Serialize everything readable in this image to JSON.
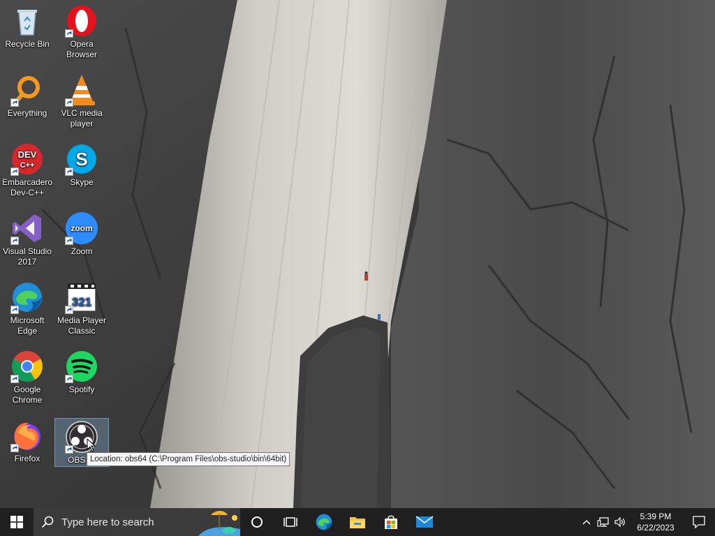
{
  "desktop": {
    "icons": [
      {
        "label": "Recycle Bin",
        "icon": "recycle-bin-icon"
      },
      {
        "label": "Opera Browser",
        "icon": "opera-icon"
      },
      {
        "label": "Everything",
        "icon": "everything-search-icon"
      },
      {
        "label": "VLC media player",
        "icon": "vlc-icon"
      },
      {
        "label": "Embarcadero Dev-C++",
        "icon": "devcpp-icon"
      },
      {
        "label": "Skype",
        "icon": "skype-icon"
      },
      {
        "label": "Visual Studio 2017",
        "icon": "visual-studio-icon"
      },
      {
        "label": "Zoom",
        "icon": "zoom-icon"
      },
      {
        "label": "Microsoft Edge",
        "icon": "edge-icon"
      },
      {
        "label": "Media Player Classic",
        "icon": "media-player-classic-icon"
      },
      {
        "label": "Google Chrome",
        "icon": "chrome-icon"
      },
      {
        "label": "Spotify",
        "icon": "spotify-icon"
      },
      {
        "label": "Firefox",
        "icon": "firefox-icon"
      },
      {
        "label": "OBS St",
        "icon": "obs-icon"
      }
    ],
    "selected": "OBS Studio",
    "tooltip": "Location: obs64 (C:\\Program Files\\obs-studio\\bin\\64bit)",
    "dev_badge": "DEV",
    "dev_badge2": "C++",
    "mpc_badge": "321",
    "zoom_badge": "zoom"
  },
  "taskbar": {
    "search_placeholder": "Type here to search",
    "pinned": [
      "cortana-icon",
      "task-view-icon",
      "edge-icon",
      "file-explorer-icon",
      "microsoft-store-icon",
      "mail-icon"
    ],
    "clock_time": "5:39 PM",
    "clock_date": "6/22/2023"
  },
  "colors": {
    "taskbar": "#1f1f1f",
    "search_box": "#3b3b3b",
    "selection": "#99d1ff"
  }
}
